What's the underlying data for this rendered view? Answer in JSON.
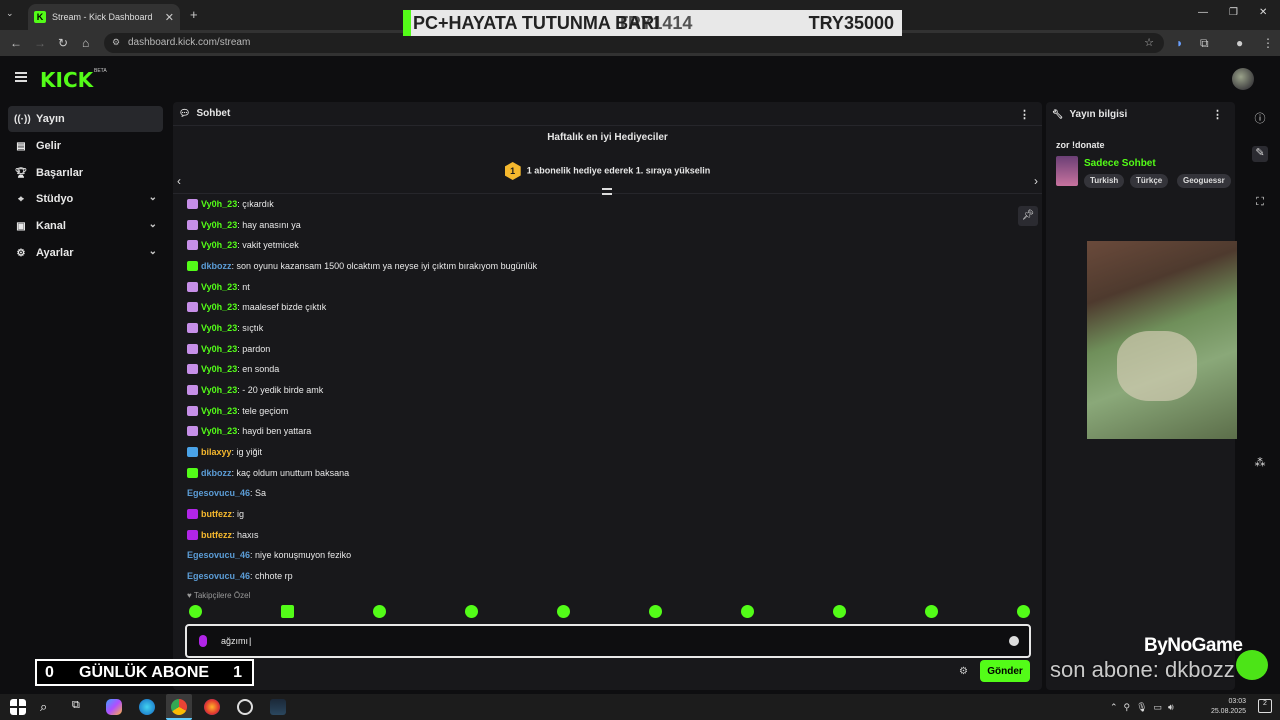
{
  "browser": {
    "tab_title": "Stream - Kick Dashboard",
    "url": "dashboard.kick.com/stream"
  },
  "overlay_banner": {
    "title": "PC+HAYATA TUTUNMA BARI",
    "current": "TRY1414",
    "goal": "TRY35000"
  },
  "app": {
    "logo": "KICK",
    "beta": "BETA"
  },
  "sidebar": {
    "items": [
      {
        "label": "Yayın",
        "icon": "broadcast-icon"
      },
      {
        "label": "Gelir",
        "icon": "revenue-icon"
      },
      {
        "label": "Başarılar",
        "icon": "trophy-icon"
      },
      {
        "label": "Stüdyo",
        "icon": "studio-icon"
      },
      {
        "label": "Kanal",
        "icon": "channel-icon"
      },
      {
        "label": "Ayarlar",
        "icon": "settings-icon"
      }
    ]
  },
  "chat": {
    "title": "Sohbet",
    "gifters_title": "Haftalık en iyi Hediyeciler",
    "gifters_subtitle": "1 abonelik hediye ederek 1. sıraya yükselin",
    "gifters_rank": "1",
    "messages": [
      {
        "user": "Vy0h_23",
        "text": "çıkardık",
        "color": "#53fc18"
      },
      {
        "user": "Vy0h_23",
        "text": "hay anasını ya",
        "color": "#53fc18"
      },
      {
        "user": "Vy0h_23",
        "text": "vakit yetmicek",
        "color": "#53fc18"
      },
      {
        "user": "dkbozz",
        "text": "son oyunu kazansam 1500 olcaktım ya neyse iyi çıktım bırakıyom bugünlük",
        "color": "#5b9cd6"
      },
      {
        "user": "Vy0h_23",
        "text": "nt",
        "color": "#53fc18"
      },
      {
        "user": "Vy0h_23",
        "text": "maalesef bizde çıktık",
        "color": "#53fc18"
      },
      {
        "user": "Vy0h_23",
        "text": "sıçtık",
        "color": "#53fc18"
      },
      {
        "user": "Vy0h_23",
        "text": "pardon",
        "color": "#53fc18"
      },
      {
        "user": "Vy0h_23",
        "text": "en sonda",
        "color": "#53fc18"
      },
      {
        "user": "Vy0h_23",
        "text": "- 20 yedik birde amk",
        "color": "#53fc18"
      },
      {
        "user": "Vy0h_23",
        "text": "tele geçiom",
        "color": "#53fc18"
      },
      {
        "user": "Vy0h_23",
        "text": "haydi ben yattara",
        "color": "#53fc18"
      },
      {
        "user": "bilaxyy",
        "text": "ig yiğit",
        "color": "#f5b82e"
      },
      {
        "user": "dkbozz",
        "text": "kaç oldum unuttum baksana",
        "color": "#5b9cd6"
      },
      {
        "user": "Egesovucu_46",
        "text": "Sa",
        "color": "#5b9cd6"
      },
      {
        "user": "butfezz",
        "text": "ig",
        "color": "#f5b82e"
      },
      {
        "user": "butfezz",
        "text": "haxıs",
        "color": "#f5b82e"
      },
      {
        "user": "Egesovucu_46",
        "text": "niye konuşmuyon feziko",
        "color": "#5b9cd6"
      },
      {
        "user": "Egesovucu_46",
        "text": "chhote rp",
        "color": "#5b9cd6"
      }
    ],
    "followers_only_label": "Takipçilere Özel",
    "input_value": "ağzımı",
    "send_label": "Gönder",
    "sep": ": "
  },
  "stream_info": {
    "title": "Yayın bilgisi",
    "stream_title": "zor !donate",
    "category": "Sadece Sohbet",
    "tags": [
      "Turkish",
      "Türkçe",
      "Geoguessr"
    ]
  },
  "overlays": {
    "sub_left": "0",
    "sub_label": "GÜNLÜK ABONE",
    "sub_right": "1",
    "last_sub": "son abone: dkbozz",
    "sponsor": "ByNoGame"
  },
  "taskbar": {
    "time": "03:03",
    "date": "25.08.2025",
    "notifications": "2"
  }
}
